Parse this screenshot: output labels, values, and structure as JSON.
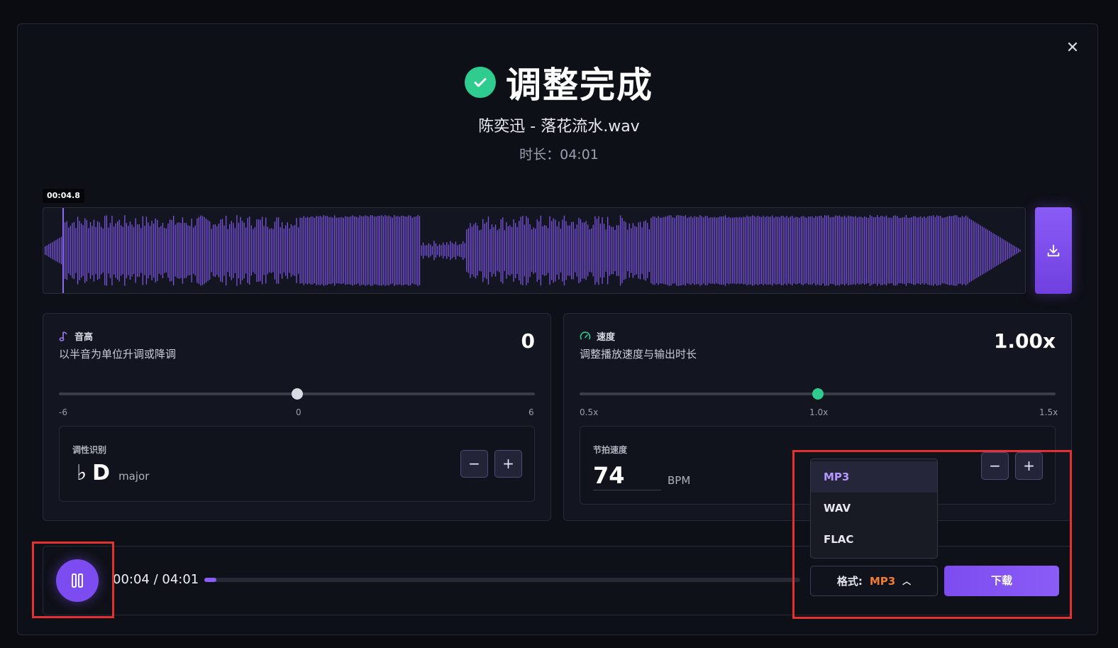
{
  "header": {
    "title": "调整完成",
    "filename": "陈奕迅 - 落花流水.wav",
    "duration": "时长：04:01"
  },
  "waveform": {
    "playhead_time": "00:04.8",
    "played_fraction": 0.02,
    "bar_color": "#7b55e0"
  },
  "pitch": {
    "label": "音高",
    "description": "以半音为单位升调或降调",
    "value": "0",
    "slider": {
      "min": -6,
      "max": 6,
      "current": 0
    },
    "ticks": [
      "-6",
      "0",
      "6"
    ],
    "key_detect_label": "调性识别",
    "key_accidental": "♭",
    "key_name": "D",
    "key_mode": "major",
    "minus": "−",
    "plus": "+"
  },
  "speed": {
    "label": "速度",
    "description": "调整播放速度与输出时长",
    "value": "1.00x",
    "slider": {
      "min": 0.5,
      "max": 1.5,
      "current": 1.0
    },
    "ticks": [
      "0.5x",
      "1.0x",
      "1.5x"
    ],
    "bpm_label": "节拍速度",
    "bpm_value": "74",
    "bpm_unit": "BPM",
    "minus": "−",
    "plus": "+"
  },
  "player": {
    "time": "00:04 / 04:01",
    "progress": 0.02
  },
  "format": {
    "label": "格式:",
    "selected": "MP3",
    "options": [
      "MP3",
      "WAV",
      "FLAC"
    ]
  },
  "download_label": "下载",
  "colors": {
    "accent": "#7c4cf0",
    "success": "#2ecc8f",
    "format_highlight": "#f27c30",
    "highlight_box": "#e53030"
  },
  "icons": {
    "close": "close-icon",
    "check": "check-icon",
    "download": "download-icon",
    "pitch": "music-note-icon",
    "speed": "speedometer-icon",
    "pause": "pause-icon"
  }
}
